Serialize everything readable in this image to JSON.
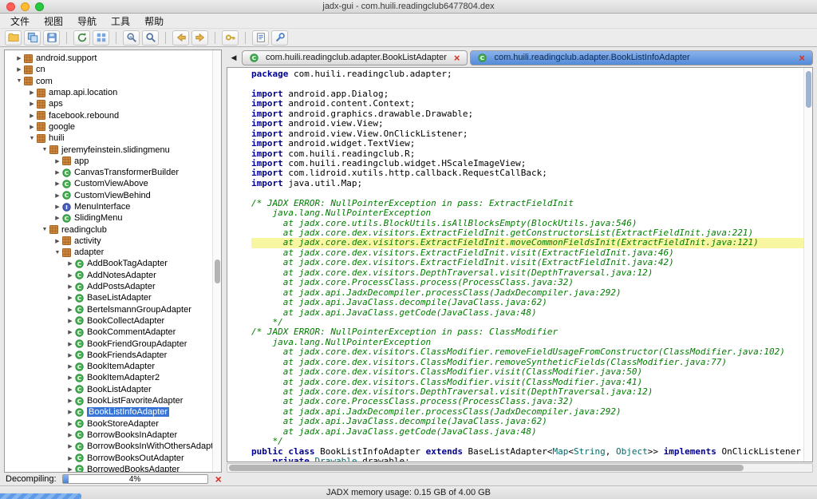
{
  "window": {
    "title": "jadx-gui - com.huili.readingclub6477804.dex"
  },
  "menubar": {
    "items": [
      "文件",
      "视图",
      "导航",
      "工具",
      "帮助"
    ]
  },
  "toolbar": {
    "groups": [
      [
        "open-file",
        "save-all",
        "export-gradle"
      ],
      [
        "reload",
        "deobfuscation"
      ],
      [
        "text-search",
        "class-search"
      ],
      [
        "nav-back",
        "nav-forward"
      ],
      [
        "quark"
      ],
      [
        "log-viewer",
        "preferences"
      ]
    ]
  },
  "tree": {
    "items": [
      {
        "d": 1,
        "a": "r",
        "i": "pkg",
        "t": "android.support"
      },
      {
        "d": 1,
        "a": "r",
        "i": "pkg",
        "t": "cn"
      },
      {
        "d": 1,
        "a": "d",
        "i": "pkg",
        "t": "com"
      },
      {
        "d": 2,
        "a": "r",
        "i": "pkg",
        "t": "amap.api.location"
      },
      {
        "d": 2,
        "a": "r",
        "i": "pkg",
        "t": "aps"
      },
      {
        "d": 2,
        "a": "r",
        "i": "pkg",
        "t": "facebook.rebound"
      },
      {
        "d": 2,
        "a": "r",
        "i": "pkg",
        "t": "google"
      },
      {
        "d": 2,
        "a": "d",
        "i": "pkg",
        "t": "huili"
      },
      {
        "d": 3,
        "a": "d",
        "i": "pkg",
        "t": "jeremyfeinstein.slidingmenu"
      },
      {
        "d": 4,
        "a": "r",
        "i": "pkg",
        "t": "app"
      },
      {
        "d": 4,
        "a": "r",
        "i": "cls",
        "t": "CanvasTransformerBuilder"
      },
      {
        "d": 4,
        "a": "r",
        "i": "cls",
        "t": "CustomViewAbove"
      },
      {
        "d": 4,
        "a": "r",
        "i": "cls",
        "t": "CustomViewBehind"
      },
      {
        "d": 4,
        "a": "r",
        "i": "ifc",
        "t": "MenuInterface"
      },
      {
        "d": 4,
        "a": "r",
        "i": "cls",
        "t": "SlidingMenu"
      },
      {
        "d": 3,
        "a": "d",
        "i": "pkg",
        "t": "readingclub"
      },
      {
        "d": 4,
        "a": "r",
        "i": "pkg",
        "t": "activity"
      },
      {
        "d": 4,
        "a": "d",
        "i": "pkg",
        "t": "adapter"
      },
      {
        "d": 5,
        "a": "r",
        "i": "cls",
        "t": "AddBookTagAdapter"
      },
      {
        "d": 5,
        "a": "r",
        "i": "cls",
        "t": "AddNotesAdapter"
      },
      {
        "d": 5,
        "a": "r",
        "i": "cls",
        "t": "AddPostsAdapter"
      },
      {
        "d": 5,
        "a": "r",
        "i": "cls",
        "t": "BaseListAdapter"
      },
      {
        "d": 5,
        "a": "r",
        "i": "cls",
        "t": "BertelsmannGroupAdapter"
      },
      {
        "d": 5,
        "a": "r",
        "i": "cls",
        "t": "BookCollectAdapter"
      },
      {
        "d": 5,
        "a": "r",
        "i": "cls",
        "t": "BookCommentAdapter"
      },
      {
        "d": 5,
        "a": "r",
        "i": "cls",
        "t": "BookFriendGroupAdapter"
      },
      {
        "d": 5,
        "a": "r",
        "i": "cls",
        "t": "BookFriendsAdapter"
      },
      {
        "d": 5,
        "a": "r",
        "i": "cls",
        "t": "BookItemAdapter"
      },
      {
        "d": 5,
        "a": "r",
        "i": "cls",
        "t": "BookItemAdapter2"
      },
      {
        "d": 5,
        "a": "r",
        "i": "cls",
        "t": "BookListAdapter"
      },
      {
        "d": 5,
        "a": "r",
        "i": "cls",
        "t": "BookListFavoriteAdapter"
      },
      {
        "d": 5,
        "a": "r",
        "i": "cls",
        "t": "BookListInfoAdapter",
        "sel": true
      },
      {
        "d": 5,
        "a": "r",
        "i": "cls",
        "t": "BookStoreAdapter"
      },
      {
        "d": 5,
        "a": "r",
        "i": "cls",
        "t": "BorrowBooksInAdapter"
      },
      {
        "d": 5,
        "a": "r",
        "i": "cls",
        "t": "BorrowBooksInWithOthersAdapter"
      },
      {
        "d": 5,
        "a": "r",
        "i": "cls",
        "t": "BorrowBooksOutAdapter"
      },
      {
        "d": 5,
        "a": "r",
        "i": "cls",
        "t": "BorrowedBooksAdapter"
      }
    ]
  },
  "editor": {
    "tabs_nav_left": "◀",
    "tabs": [
      {
        "label": "com.huili.readingclub.adapter.BookListAdapter",
        "icon": "class",
        "active": false
      },
      {
        "label": "com.huili.readingclub.adapter.BookListInfoAdapter",
        "icon": "class",
        "active": true
      }
    ],
    "highlight_index": 17,
    "code_lines": [
      [
        [
          "k",
          "package"
        ],
        [
          "p",
          " com.huili.readingclub.adapter;"
        ]
      ],
      [],
      [
        [
          "k",
          "import"
        ],
        [
          "p",
          " android.app.Dialog;"
        ]
      ],
      [
        [
          "k",
          "import"
        ],
        [
          "p",
          " android.content.Context;"
        ]
      ],
      [
        [
          "k",
          "import"
        ],
        [
          "p",
          " android.graphics.drawable.Drawable;"
        ]
      ],
      [
        [
          "k",
          "import"
        ],
        [
          "p",
          " android.view.View;"
        ]
      ],
      [
        [
          "k",
          "import"
        ],
        [
          "p",
          " android.view.View.OnClickListener;"
        ]
      ],
      [
        [
          "k",
          "import"
        ],
        [
          "p",
          " android.widget.TextView;"
        ]
      ],
      [
        [
          "k",
          "import"
        ],
        [
          "p",
          " com.huili.readingclub.R;"
        ]
      ],
      [
        [
          "k",
          "import"
        ],
        [
          "p",
          " com.huili.readingclub.widget.HScaleImageView;"
        ]
      ],
      [
        [
          "k",
          "import"
        ],
        [
          "p",
          " com.lidroid.xutils.http.callback.RequestCallBack;"
        ]
      ],
      [
        [
          "k",
          "import"
        ],
        [
          "p",
          " java.util.Map;"
        ]
      ],
      [],
      [
        [
          "c",
          "/* JADX ERROR: NullPointerException in pass: ExtractFieldInit"
        ]
      ],
      [
        [
          "c",
          "    java.lang.NullPointerException"
        ]
      ],
      [
        [
          "c",
          "      at jadx.core.utils.BlockUtils.isAllBlocksEmpty(BlockUtils.java:546)"
        ]
      ],
      [
        [
          "c",
          "      at jadx.core.dex.visitors.ExtractFieldInit.getConstructorsList(ExtractFieldInit.java:221)"
        ]
      ],
      [
        [
          "c",
          "      at jadx.core.dex.visitors.ExtractFieldInit.moveCommonFieldsInit(ExtractFieldInit.java:121)"
        ]
      ],
      [
        [
          "c",
          "      at jadx.core.dex.visitors.ExtractFieldInit.visit(ExtractFieldInit.java:46)"
        ]
      ],
      [
        [
          "c",
          "      at jadx.core.dex.visitors.ExtractFieldInit.visit(ExtractFieldInit.java:42)"
        ]
      ],
      [
        [
          "c",
          "      at jadx.core.dex.visitors.DepthTraversal.visit(DepthTraversal.java:12)"
        ]
      ],
      [
        [
          "c",
          "      at jadx.core.ProcessClass.process(ProcessClass.java:32)"
        ]
      ],
      [
        [
          "c",
          "      at jadx.api.JadxDecompiler.processClass(JadxDecompiler.java:292)"
        ]
      ],
      [
        [
          "c",
          "      at jadx.api.JavaClass.decompile(JavaClass.java:62)"
        ]
      ],
      [
        [
          "c",
          "      at jadx.api.JavaClass.getCode(JavaClass.java:48)"
        ]
      ],
      [
        [
          "c",
          "    */"
        ]
      ],
      [
        [
          "c",
          "/* JADX ERROR: NullPointerException in pass: ClassModifier"
        ]
      ],
      [
        [
          "c",
          "    java.lang.NullPointerException"
        ]
      ],
      [
        [
          "c",
          "      at jadx.core.dex.visitors.ClassModifier.removeFieldUsageFromConstructor(ClassModifier.java:102)"
        ]
      ],
      [
        [
          "c",
          "      at jadx.core.dex.visitors.ClassModifier.removeSyntheticFields(ClassModifier.java:77)"
        ]
      ],
      [
        [
          "c",
          "      at jadx.core.dex.visitors.ClassModifier.visit(ClassModifier.java:50)"
        ]
      ],
      [
        [
          "c",
          "      at jadx.core.dex.visitors.ClassModifier.visit(ClassModifier.java:41)"
        ]
      ],
      [
        [
          "c",
          "      at jadx.core.dex.visitors.DepthTraversal.visit(DepthTraversal.java:12)"
        ]
      ],
      [
        [
          "c",
          "      at jadx.core.ProcessClass.process(ProcessClass.java:32)"
        ]
      ],
      [
        [
          "c",
          "      at jadx.api.JadxDecompiler.processClass(JadxDecompiler.java:292)"
        ]
      ],
      [
        [
          "c",
          "      at jadx.api.JavaClass.decompile(JavaClass.java:62)"
        ]
      ],
      [
        [
          "c",
          "      at jadx.api.JavaClass.getCode(JavaClass.java:48)"
        ]
      ],
      [
        [
          "c",
          "    */"
        ]
      ],
      [
        [
          "k",
          "public"
        ],
        [
          "p",
          " "
        ],
        [
          "k",
          "class"
        ],
        [
          "p",
          " BookListInfoAdapter "
        ],
        [
          "k",
          "extends"
        ],
        [
          "p",
          " BaseListAdapter<"
        ],
        [
          "t",
          "Map"
        ],
        [
          "p",
          "<"
        ],
        [
          "t",
          "String"
        ],
        [
          "p",
          ", "
        ],
        [
          "t",
          "Object"
        ],
        [
          "p",
          ">> "
        ],
        [
          "k",
          "implements"
        ],
        [
          "p",
          " OnClickListener {"
        ]
      ],
      [
        [
          "p",
          "    "
        ],
        [
          "k",
          "private"
        ],
        [
          "p",
          " "
        ],
        [
          "t",
          "Drawable"
        ],
        [
          "p",
          " drawable;"
        ]
      ]
    ]
  },
  "progress_panel": {
    "label": "Decompiling:",
    "percent_text": "4%",
    "percent_value": 4,
    "cancel_glyph": "×"
  },
  "statusbar": {
    "memory_text": "JADX memory usage: 0.15 GB of 4.00 GB"
  },
  "glyphs": {
    "close": "×",
    "arrow_right": "▶",
    "arrow_down": "▼"
  },
  "colors": {
    "selection": "#3874d6",
    "keyword": "#000090",
    "comment": "#007d00",
    "type": "#006a6a",
    "highlight_line": "#f9f6a2",
    "tab_active_top": "#8ab2ec",
    "tab_active_bottom": "#538ad8",
    "progress_fill": "#4781d4",
    "traffic_red": "#ff5f57",
    "traffic_yellow": "#febc2e",
    "traffic_green": "#28c840",
    "close_red": "#d93025"
  }
}
